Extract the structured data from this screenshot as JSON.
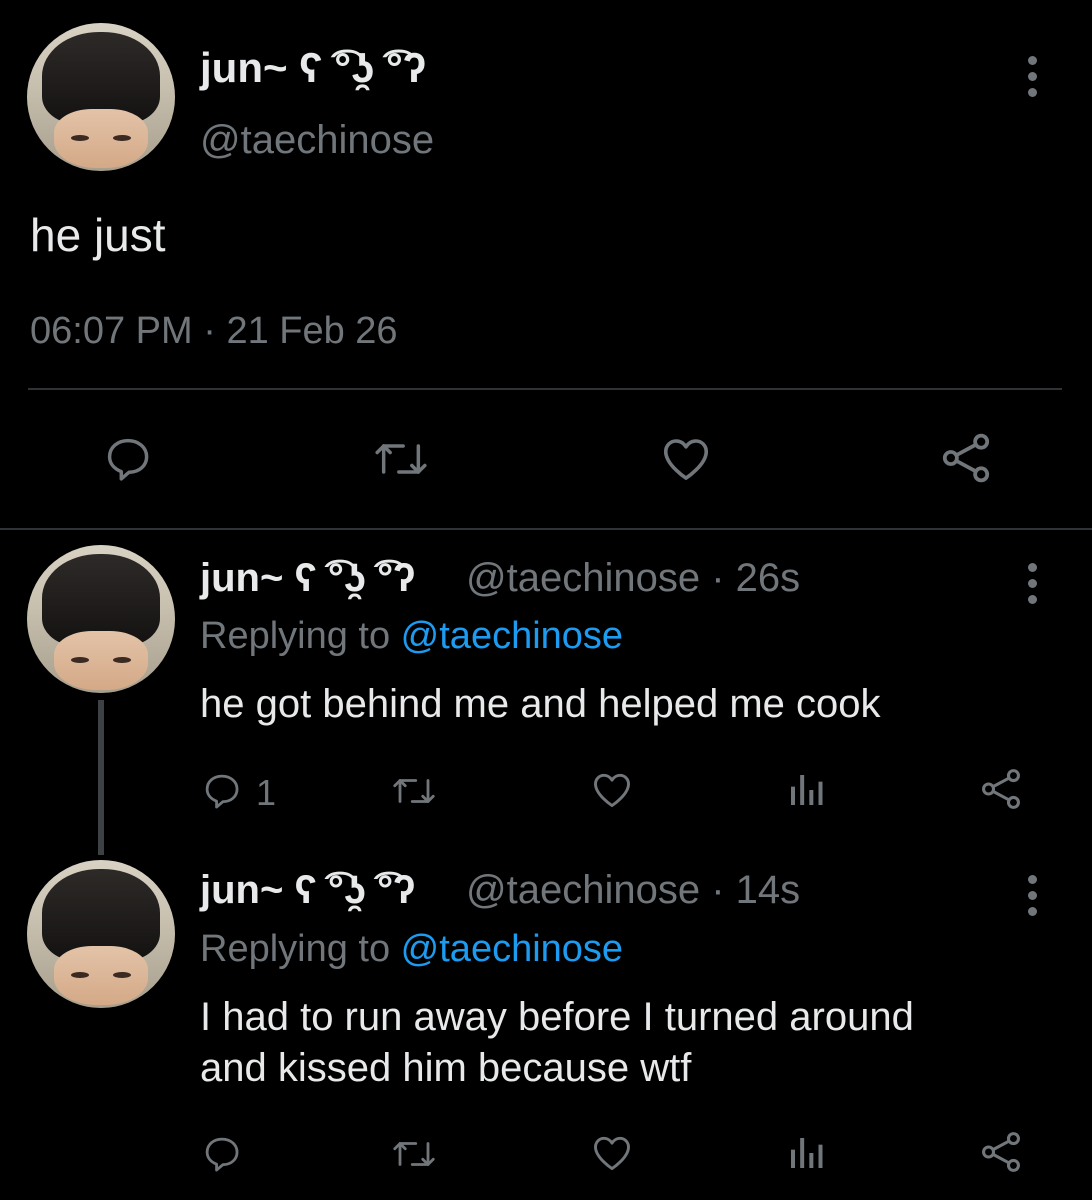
{
  "main_tweet": {
    "display_name": "jun~ ʕ ͡°ʖ̯ ͡°ʔ",
    "handle": "@taechinose",
    "text": "he just",
    "time": "06:07 PM",
    "separator": "·",
    "date": "21 Feb 26"
  },
  "replies": [
    {
      "display_name": "jun~ ʕ ͡°ʖ̯ ͡°ʔ",
      "handle": "@taechinose",
      "age": "· 26s",
      "replying_prefix": "Replying to ",
      "replying_to": "@taechinose",
      "text": "he got behind me and helped me cook",
      "reply_count": "1"
    },
    {
      "display_name": "jun~ ʕ ͡°ʖ̯ ͡°ʔ",
      "handle": "@taechinose",
      "age": "· 14s",
      "replying_prefix": "Replying to ",
      "replying_to": "@taechinose",
      "text_line1": "I had to run away before I turned around",
      "text_line2": "and kissed him because wtf",
      "reply_count": ""
    }
  ],
  "colors": {
    "background": "#000000",
    "text": "#e7e9ea",
    "muted": "#71767b",
    "link": "#1d9bf0",
    "divider": "#2f3336"
  },
  "icons": [
    "more-icon",
    "reply-icon",
    "retweet-icon",
    "like-icon",
    "share-icon",
    "analytics-icon"
  ]
}
